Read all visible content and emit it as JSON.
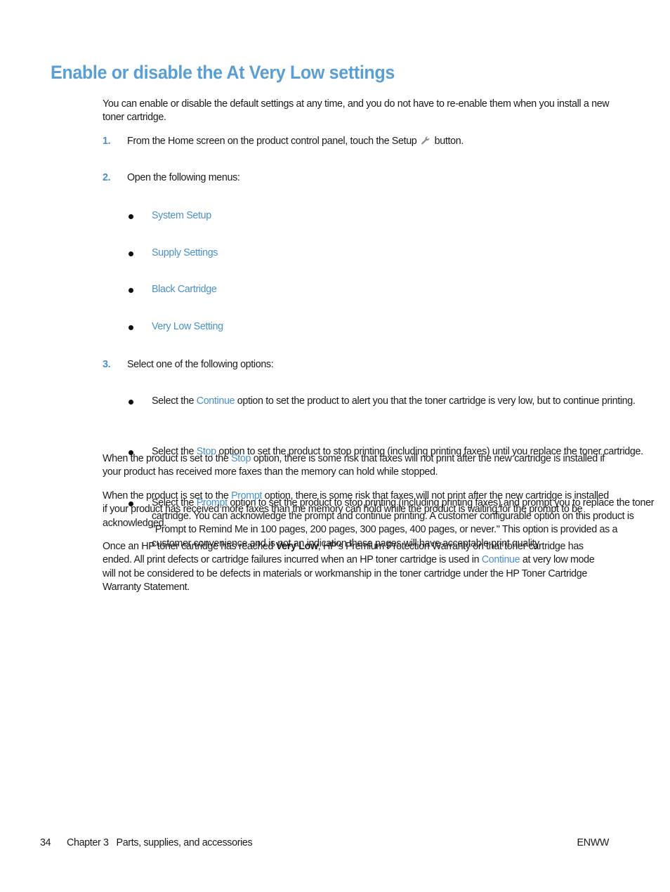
{
  "title": "Enable or disable the At Very Low settings",
  "intro": "You can enable or disable the default settings at any time, and you do not have to re-enable them when you install a new toner cartridge.",
  "steps": [
    {
      "number": "1.",
      "text_before": "From the Home screen on the product control panel, touch the Setup",
      "icon": "wrench-icon",
      "text_after": "button."
    },
    {
      "number": "2.",
      "text": "Open the following menus:",
      "menus": [
        "System Setup",
        "Supply Settings",
        "Black Cartridge",
        "Very Low Setting"
      ]
    },
    {
      "number": "3.",
      "text": "Select one of the following options:",
      "options": [
        {
          "prefix": "Select the ",
          "option": "Continue",
          "suffix": " option to set the product to alert you that the toner cartridge is very low, but to continue printing."
        },
        {
          "prefix": "Select the ",
          "option": "Stop",
          "suffix": " option to set the product to stop printing (including printing faxes) until you replace the toner cartridge."
        },
        {
          "prefix": "Select the ",
          "option": "Prompt",
          "suffix": " option to set the product to stop printing (including printing faxes) and prompt you to replace the toner cartridge. You can acknowledge the prompt and continue printing. A customer configurable option on this product is \"Prompt to Remind Me in 100 pages, 200 pages, 300 pages, 400 pages, or never.\" This option is provided as a customer convenience and is not an indication these pages will have acceptable print quality."
        }
      ]
    }
  ],
  "paragraphs": [
    {
      "prefix": "When the product is set to the ",
      "option": "Stop",
      "suffix": " option, there is some risk that faxes will not print after the new cartridge is installed if your product has received more faxes than the memory can hold while stopped."
    },
    {
      "prefix": "When the product is set to the ",
      "option": "Prompt",
      "suffix": " option, there is some risk that faxes will not print after the new cartridge is installed if your product has received more faxes than the memory can hold while the product is waiting for the prompt to be acknowledged."
    }
  ],
  "warranty": {
    "p1": "Once an HP toner cartridge has reached ",
    "bold": "Very Low",
    "p2": ", HP’s Premium Protection Warranty on that toner cartridge has ended. All print defects or cartridge failures incurred when an HP toner cartridge is used in ",
    "option": "Continue",
    "p3": " at very low mode will not be considered to be defects in materials or workmanship in the toner cartridge under the HP Toner Cartridge Warranty Statement."
  },
  "footer": {
    "page_number": "34",
    "chapter": "Chapter 3   Parts, supplies, and accessories",
    "locale": "ENWW"
  },
  "colors": {
    "accent": "#5a9fd4",
    "link": "#4a90cc"
  }
}
